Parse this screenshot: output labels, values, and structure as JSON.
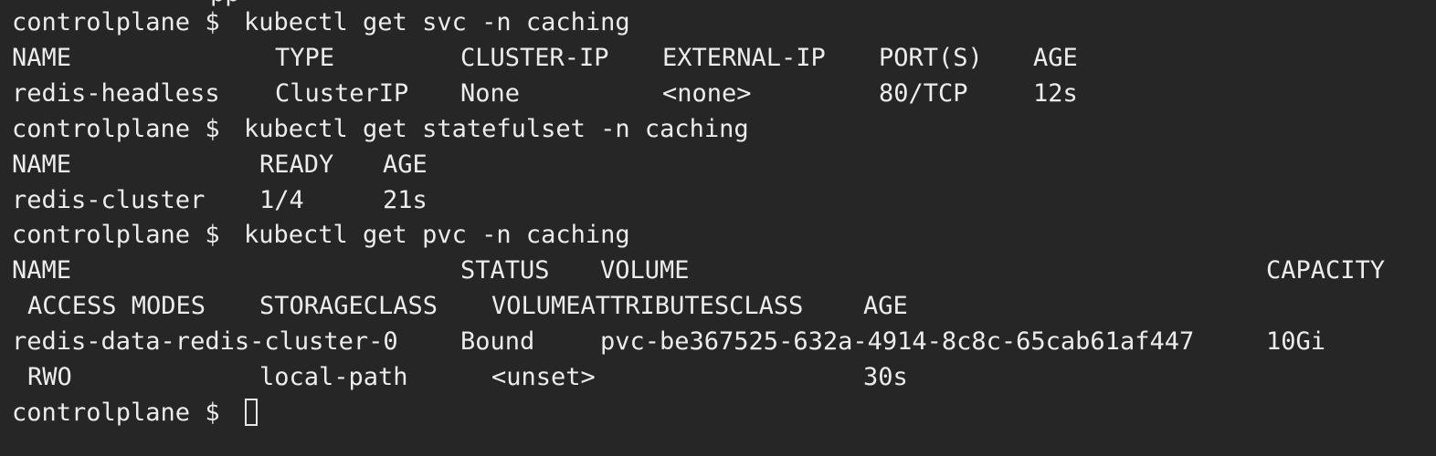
{
  "terminal": {
    "prompt": "controlplane $",
    "partial_top_line": "pp",
    "commands": {
      "svc": "kubectl get svc -n caching",
      "statefulset": "kubectl get statefulset -n caching",
      "pvc": "kubectl get pvc -n caching"
    },
    "svc_table": {
      "headers": [
        "NAME",
        "TYPE",
        "CLUSTER-IP",
        "EXTERNAL-IP",
        "PORT(S)",
        "AGE"
      ],
      "rows": [
        [
          "redis-headless",
          "ClusterIP",
          "None",
          "<none>",
          "80/TCP",
          "12s"
        ]
      ]
    },
    "statefulset_table": {
      "headers": [
        "NAME",
        "READY",
        "AGE"
      ],
      "rows": [
        [
          "redis-cluster",
          "1/4",
          "21s"
        ]
      ]
    },
    "pvc_table": {
      "headers_line1": [
        "NAME",
        "STATUS",
        "VOLUME",
        "CAPACITY"
      ],
      "headers_line2": [
        "ACCESS MODES",
        "STORAGECLASS",
        "VOLUMEATTRIBUTESCLASS",
        "AGE"
      ],
      "row_line1": [
        "redis-data-redis-cluster-0",
        "Bound",
        "pvc-be367525-632a-4914-8c8c-65cab61af447",
        "10Gi"
      ],
      "row_line2": [
        "RWO",
        "local-path",
        "<unset>",
        "30s"
      ]
    },
    "colors": {
      "background": "#262626",
      "text": "#ececec"
    }
  }
}
